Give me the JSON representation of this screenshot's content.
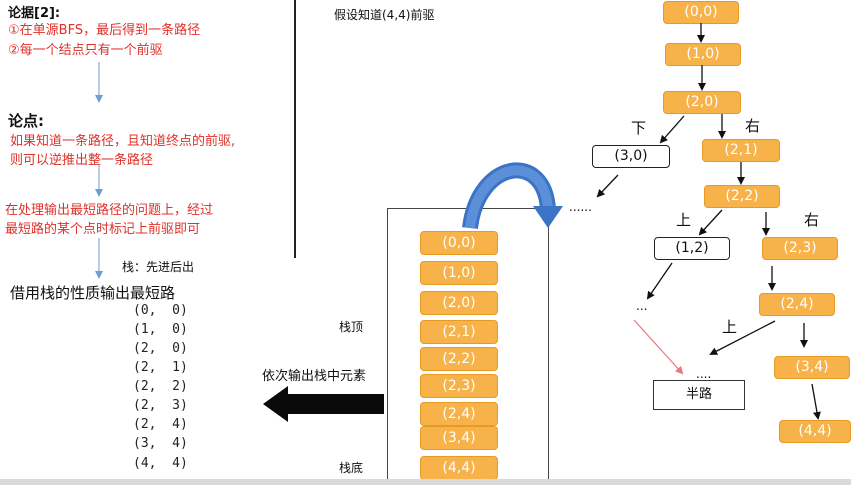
{
  "left_panel": {
    "argument_title": "论据[2]:",
    "argument_1": "①在单源BFS，最后得到一条路径",
    "argument_2": "②每一个结点只有一个前驱",
    "point_title": "论点:",
    "point_1": "如果知道一条路径，且知道终点的前驱,",
    "point_2": "则可以逆推出整一条路径",
    "method_1": "在处理输出最短路径的问题上，经过",
    "method_2": "最短路的某个点时标记上前驱即可",
    "stack_note": "栈：先进后出",
    "output_title": "借用栈的性质输出最短路",
    "output_values": [
      "(0,  0)",
      "(1,  0)",
      "(2,  0)",
      "(2,  1)",
      "(2,  2)",
      "(2,  3)",
      "(2,  4)",
      "(3,  4)",
      "(4,  4)"
    ]
  },
  "stack": {
    "top_label": "栈顶",
    "bottom_label": "栈底",
    "pop_label": "依次输出栈中元素",
    "items": [
      "(0,0)",
      "(1,0)",
      "(2,0)",
      "(2,1)",
      "(2,2)",
      "(2,3)",
      "(2,4)",
      "(3,4)",
      "(4,4)"
    ]
  },
  "tree": {
    "assumption": "假设知道(4,4)前驱",
    "nodes": [
      "(0,0)",
      "(1,0)",
      "(2,0)",
      "(3,0)",
      "(2,1)",
      "(2,2)",
      "(1,2)",
      "(2,3)",
      "(2,4)",
      "(3,4)",
      "(4,4)"
    ],
    "labels": {
      "down_1": "下",
      "right_1": "右",
      "up_1": "上",
      "right_2": "右",
      "up_2": "上"
    },
    "ellipsis_1": "......",
    "ellipsis_2": "...",
    "ellipsis_3": "....",
    "halfway": "半路"
  },
  "colors": {
    "node_fill": "#f8b24a",
    "node_border": "#e59b25",
    "red_text": "#e0302a",
    "curve_arrow": "#3b73c7"
  }
}
